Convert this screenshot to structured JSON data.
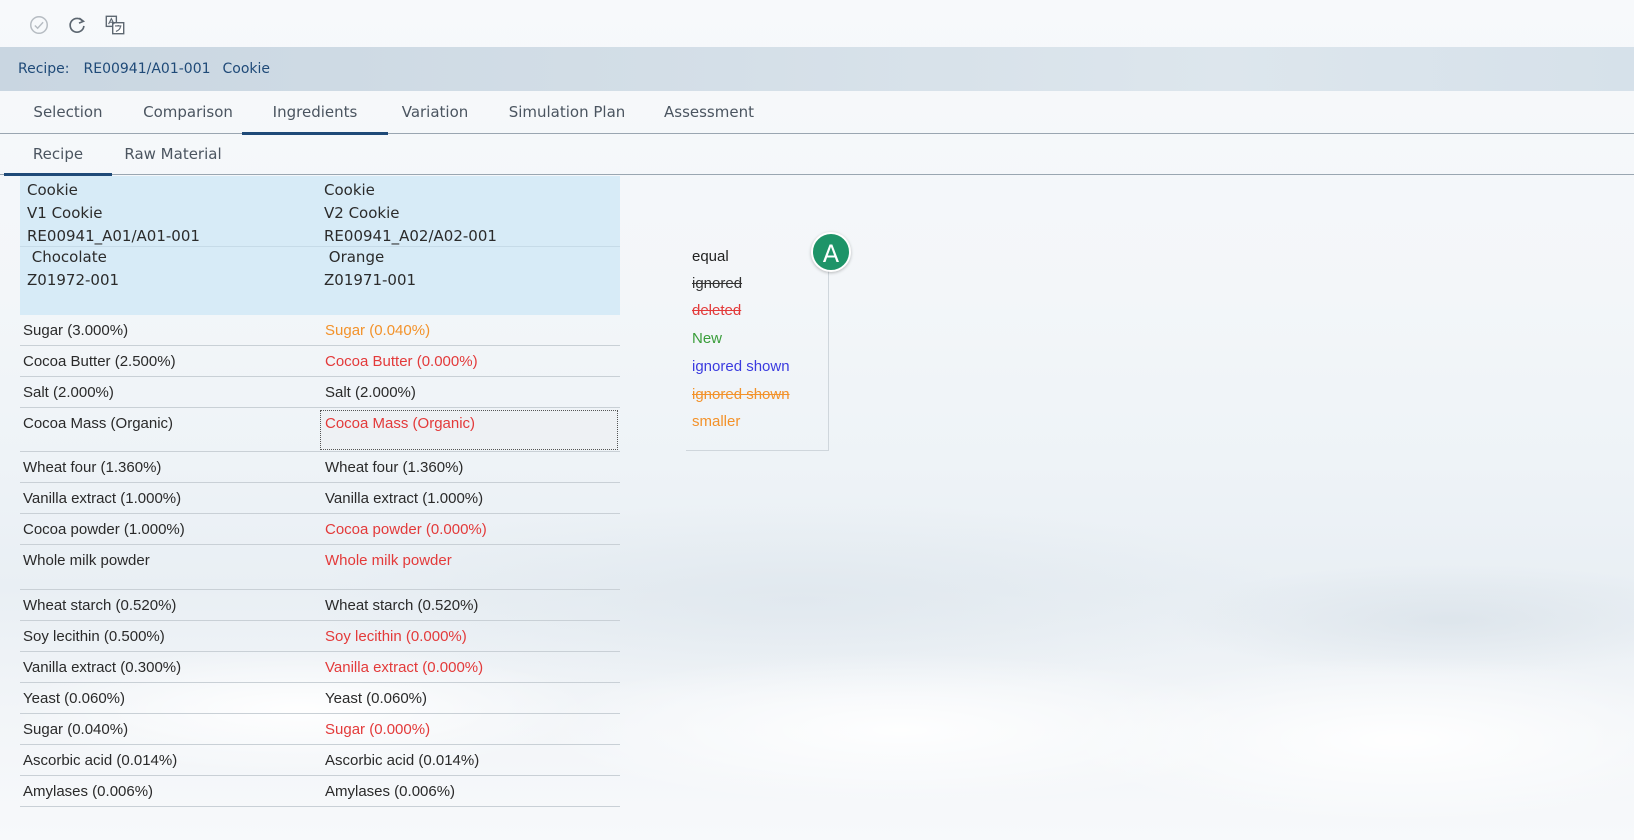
{
  "toolbar": {
    "icons": [
      "check-circle-icon",
      "refresh-icon",
      "translate-icon"
    ]
  },
  "recipe_header": {
    "label": "Recipe:",
    "code": "RE00941/A01-001",
    "name": "Cookie"
  },
  "tabs": [
    {
      "label": "Selection"
    },
    {
      "label": "Comparison"
    },
    {
      "label": "Ingredients",
      "active": true
    },
    {
      "label": "Variation"
    },
    {
      "label": "Simulation Plan"
    },
    {
      "label": "Assessment"
    }
  ],
  "subtabs": [
    {
      "label": "Recipe",
      "active": true
    },
    {
      "label": "Raw Material"
    }
  ],
  "compare": {
    "left": {
      "name": "Cookie",
      "version": "V1 Cookie",
      "code": "RE00941_A01/A01-001",
      "variant": " Chocolate",
      "variant_code": "Z01972-001"
    },
    "right": {
      "name": "Cookie",
      "version": "V2 Cookie",
      "code": "RE00941_A02/A02-001",
      "variant": " Orange",
      "variant_code": "Z01971-001"
    },
    "rows": [
      {
        "left": "Sugar (3.000%)",
        "right": "Sugar (0.040%)",
        "status": "smaller"
      },
      {
        "left": "Cocoa Butter (2.500%)",
        "right": "Cocoa Butter (0.000%)",
        "status": "deleted"
      },
      {
        "left": "Salt (2.000%)",
        "right": "Salt (2.000%)",
        "status": "equal"
      },
      {
        "left": "Cocoa Mass (Organic)",
        "right": "Cocoa Mass (Organic)",
        "status": "deleted",
        "selected": true
      },
      {
        "left": "Wheat four (1.360%)",
        "right": "Wheat four (1.360%)",
        "status": "equal"
      },
      {
        "left": "Vanilla extract (1.000%)",
        "right": "Vanilla extract (1.000%)",
        "status": "equal"
      },
      {
        "left": "Cocoa powder (1.000%)",
        "right": "Cocoa powder (0.000%)",
        "status": "deleted"
      },
      {
        "left": "Whole milk powder",
        "right": "Whole milk powder",
        "status": "deleted",
        "tall": true
      },
      {
        "left": "Wheat starch (0.520%)",
        "right": "Wheat starch (0.520%)",
        "status": "equal"
      },
      {
        "left": "Soy lecithin (0.500%)",
        "right": "Soy lecithin (0.000%)",
        "status": "deleted"
      },
      {
        "left": "Vanilla extract (0.300%)",
        "right": "Vanilla extract (0.000%)",
        "status": "deleted"
      },
      {
        "left": "Yeast (0.060%)",
        "right": "Yeast (0.060%)",
        "status": "equal"
      },
      {
        "left": "Sugar (0.040%)",
        "right": "Sugar (0.000%)",
        "status": "deleted"
      },
      {
        "left": "Ascorbic acid (0.014%)",
        "right": "Ascorbic acid (0.014%)",
        "status": "equal"
      },
      {
        "left": "Amylases (0.006%)",
        "right": "Amylases (0.006%)",
        "status": "equal"
      }
    ]
  },
  "legend": {
    "items": [
      {
        "label": "equal",
        "style": "equal"
      },
      {
        "label": "ignored",
        "style": "ignored"
      },
      {
        "label": "deleted",
        "style": "deleted"
      },
      {
        "label": "New",
        "style": "new"
      },
      {
        "label": "ignored shown",
        "style": "ignored-shown"
      },
      {
        "label": "ignored shown",
        "style": "ignored-shown-strike"
      },
      {
        "label": "smaller",
        "style": "smaller"
      }
    ]
  },
  "badge": {
    "label": "A",
    "color": "#1e9468"
  },
  "colors": {
    "accent": "#1f4a78",
    "deleted": "#e33a3a",
    "smaller": "#f3922a",
    "new": "#3a9d3a",
    "ignored_shown": "#3b3bdf",
    "header_bg": "#d7ebf7"
  }
}
